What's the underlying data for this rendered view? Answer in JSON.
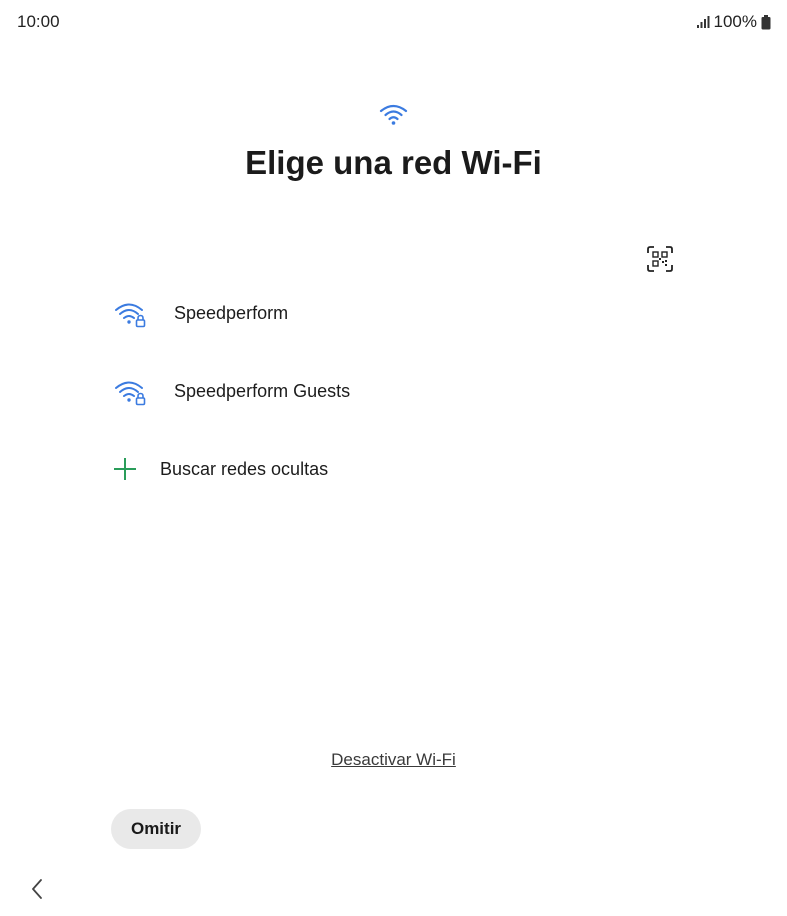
{
  "status_bar": {
    "time": "10:00",
    "battery_percent": "100%",
    "icons": [
      "signal-icon",
      "battery-icon"
    ]
  },
  "header": {
    "icon": "wifi-icon",
    "title": "Elige una red Wi-Fi"
  },
  "qr_scan": {
    "icon": "qr-code-scan-icon"
  },
  "networks": [
    {
      "name": "Speedperform",
      "icon": "wifi-lock-icon",
      "secured": true
    },
    {
      "name": "Speedperform Guests",
      "icon": "wifi-lock-icon",
      "secured": true
    }
  ],
  "hidden_networks": {
    "label": "Buscar redes ocultas",
    "icon": "plus-icon"
  },
  "disable_wifi_label": "Desactivar Wi-Fi",
  "skip_label": "Omitir",
  "nav": {
    "back_icon": "chevron-left-icon"
  },
  "colors": {
    "wifi_blue": "#3b7be0",
    "plus_green": "#2a9d5a",
    "skip_bg": "#e9e9e9"
  }
}
